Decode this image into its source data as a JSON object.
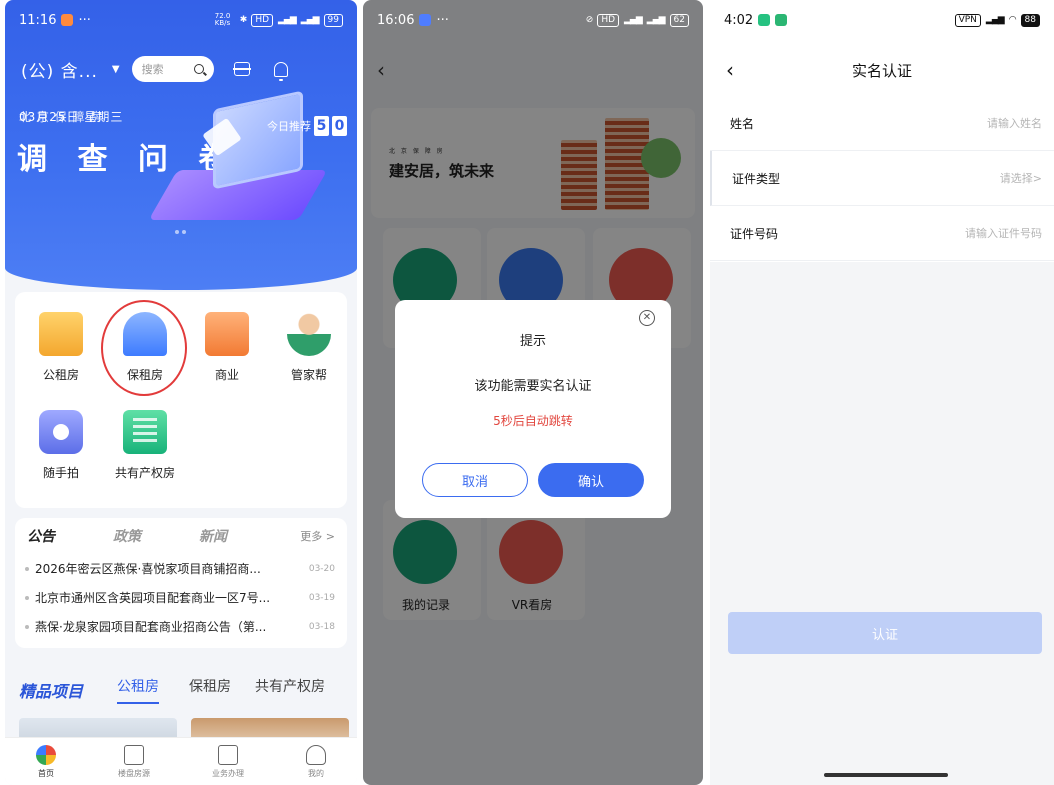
{
  "panel1": {
    "status": {
      "time": "11:16",
      "net_speed": "72.0 KB/s",
      "hd": "HD",
      "battery": "99"
    },
    "org_select": "(公) 含...",
    "search": {
      "placeholder": "搜索"
    },
    "banner": {
      "date_text": "03月25日 星期三",
      "overlay_text": "北 京 保 障 房",
      "title": "调 查 问 卷",
      "today_label": "今日推荐",
      "digits": [
        "5",
        "0"
      ]
    },
    "quick_items": [
      "公租房",
      "保租房",
      "商业",
      "管家帮",
      "随手拍",
      "共有产权房"
    ],
    "notice": {
      "tabs": [
        "公告",
        "政策",
        "新闻"
      ],
      "more": "更多 >",
      "items": [
        {
          "title": "2026年密云区燕保·喜悦家项目商铺招商...",
          "date": "03-20"
        },
        {
          "title": "北京市通州区含英园项目配套商业一区7号...",
          "date": "03-19"
        },
        {
          "title": "燕保·龙泉家园项目配套商业招商公告（第...",
          "date": "03-18"
        }
      ]
    },
    "projects": {
      "heading": "精品项目",
      "tabs": [
        "公租房",
        "保租房",
        "共有产权房"
      ]
    },
    "tabbar": [
      "首页",
      "楼盘房源",
      "业务办理",
      "我的"
    ]
  },
  "panel2": {
    "status": {
      "time": "16:06",
      "hd": "HD",
      "battery": "62"
    },
    "banner": {
      "small": "北 京 保 障 房",
      "slogan": "建安居，筑未来"
    },
    "tiles": [
      "我的记录",
      "VR看房"
    ],
    "dialog": {
      "title": "提示",
      "message": "该功能需要实名认证",
      "countdown": "5秒后自动跳转",
      "cancel": "取消",
      "confirm": "确认"
    }
  },
  "panel3": {
    "status": {
      "time": "4:02",
      "vpn": "VPN",
      "battery": "88"
    },
    "title": "实名认证",
    "fields": [
      {
        "label": "姓名",
        "placeholder": "请输入姓名"
      },
      {
        "label": "证件类型",
        "placeholder": "请选择>"
      },
      {
        "label": "证件号码",
        "placeholder": "请输入证件号码"
      }
    ],
    "submit": "认证"
  },
  "colors": {
    "primary": "#3461e8",
    "button": "#3b6cf0",
    "countdown": "#e2473f",
    "disabled": "#bfcff7"
  }
}
